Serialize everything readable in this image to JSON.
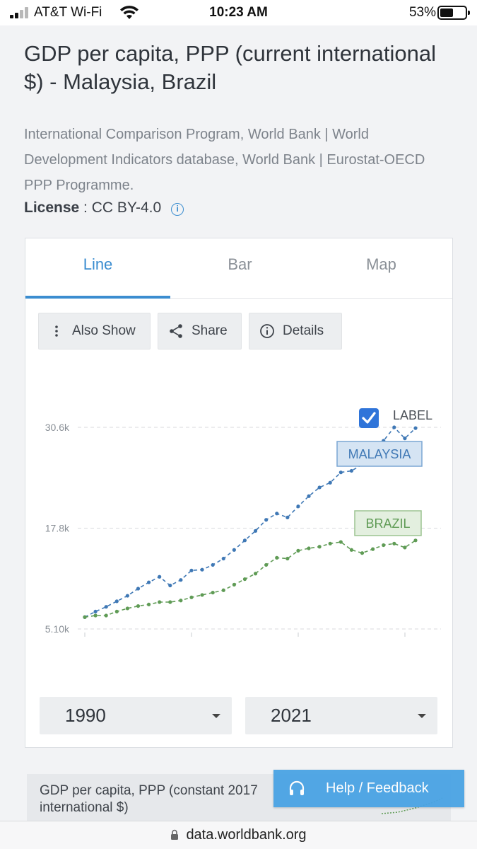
{
  "status_bar": {
    "carrier": "AT&T Wi-Fi",
    "time": "10:23 AM",
    "battery": "53%",
    "battery_level": 0.53
  },
  "page": {
    "title": "GDP per capita, PPP (current international $) - Malaysia, Brazil",
    "source": "International Comparison Program, World Bank | World Development Indicators database, World Bank | Eurostat-OECD PPP Programme.",
    "license_label": "License",
    "license_sep": " : ",
    "license_value": "CC BY-4.0"
  },
  "tabs": [
    {
      "label": "Line",
      "active": true
    },
    {
      "label": "Bar",
      "active": false
    },
    {
      "label": "Map",
      "active": false
    }
  ],
  "toolbar": {
    "also_show": "Also Show",
    "share": "Share",
    "details": "Details"
  },
  "label_toggle": {
    "text": "LABEL",
    "checked": true
  },
  "chart_data": {
    "type": "line",
    "y_ticks": [
      "30.6k",
      "17.8k",
      "5.10k"
    ],
    "ylim": [
      5100,
      30600
    ],
    "xlim": [
      1990,
      2021
    ],
    "series": [
      {
        "name": "MALAYSIA",
        "color": "#3f78b5",
        "x": [
          1990,
          1991,
          1992,
          1993,
          1994,
          1995,
          1996,
          1997,
          1998,
          1999,
          2000,
          2001,
          2002,
          2003,
          2004,
          2005,
          2006,
          2007,
          2008,
          2009,
          2010,
          2011,
          2012,
          2013,
          2014,
          2015,
          2016,
          2017,
          2018,
          2019,
          2020,
          2021
        ],
        "values": [
          6600,
          7300,
          7900,
          8600,
          9300,
          10200,
          11000,
          11700,
          10600,
          11300,
          12500,
          12600,
          13200,
          14000,
          15100,
          16300,
          17500,
          18900,
          19700,
          19200,
          20600,
          21900,
          23000,
          23600,
          24900,
          25100,
          25900,
          27400,
          28900,
          30600,
          29200,
          30500
        ]
      },
      {
        "name": "BRAZIL",
        "color": "#5f9b55",
        "x": [
          1990,
          1991,
          1992,
          1993,
          1994,
          1995,
          1996,
          1997,
          1998,
          1999,
          2000,
          2001,
          2002,
          2003,
          2004,
          2005,
          2006,
          2007,
          2008,
          2009,
          2010,
          2011,
          2012,
          2013,
          2014,
          2015,
          2016,
          2017,
          2018,
          2019,
          2020,
          2021
        ],
        "values": [
          6600,
          6800,
          6800,
          7300,
          7700,
          8000,
          8200,
          8500,
          8500,
          8700,
          9100,
          9400,
          9700,
          10000,
          10700,
          11400,
          12100,
          13200,
          14100,
          14000,
          15000,
          15300,
          15500,
          15900,
          16100,
          15100,
          14700,
          15200,
          15700,
          15900,
          15400,
          16300
        ]
      }
    ]
  },
  "range": {
    "start": "1990",
    "end": "2021"
  },
  "related": {
    "title": "GDP per capita, PPP (constant 2017 international $)"
  },
  "help": {
    "label": "Help / Feedback"
  },
  "url_bar": {
    "url": "data.worldbank.org"
  }
}
